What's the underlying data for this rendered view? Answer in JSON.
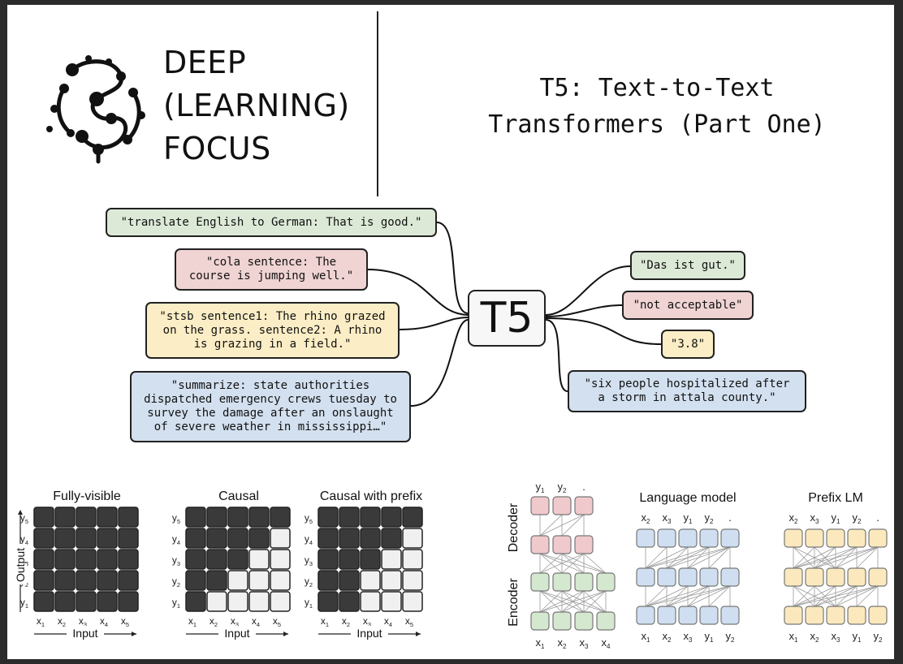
{
  "brand": {
    "line1": "DEEP",
    "line2": "(LEARNING)",
    "line3": "FOCUS"
  },
  "title": {
    "line1": "T5: Text-to-Text",
    "line2": "Transformers (Part One)"
  },
  "center_label": "T5",
  "inputs": [
    {
      "text": "\"translate English to German: That is good.\"",
      "color": "#dde9d7"
    },
    {
      "text": "\"cola sentence: The\ncourse is jumping well.\"",
      "color": "#f0d3d3"
    },
    {
      "text": "\"stsb sentence1: The rhino grazed\non the grass. sentence2: A rhino\nis grazing in a field.\"",
      "color": "#fbedc5"
    },
    {
      "text": "\"summarize: state authorities\ndispatched emergency crews tuesday to\nsurvey the damage after an onslaught\nof severe weather in mississippi…\"",
      "color": "#d3e0ef"
    }
  ],
  "outputs": [
    {
      "text": "\"Das ist gut.\"",
      "color": "#dde9d7"
    },
    {
      "text": "\"not acceptable\"",
      "color": "#f0d3d3"
    },
    {
      "text": "\"3.8\"",
      "color": "#fbedc5"
    },
    {
      "text": "\"six people hospitalized after\na storm in attala county.\"",
      "color": "#d3e0ef"
    }
  ],
  "masks": {
    "titles": [
      "Fully-visible",
      "Causal",
      "Causal with prefix"
    ],
    "y_labels": [
      "y5",
      "y4",
      "y3",
      "y2",
      "y1"
    ],
    "x_labels": [
      "x1",
      "x2",
      "x3",
      "x4",
      "x5"
    ],
    "output_label": "Output",
    "input_label": "Input"
  },
  "architectures": {
    "encoder_decoder": {
      "decoder_label": "Decoder",
      "encoder_label": "Encoder",
      "top_tokens": [
        "y1",
        "y2",
        "."
      ],
      "bottom_tokens": [
        "x1",
        "x2",
        "x3",
        "x4"
      ]
    },
    "language_model": {
      "title": "Language model",
      "top_tokens": [
        "x2",
        "x3",
        "y1",
        "y2",
        "."
      ],
      "bottom_tokens": [
        "x1",
        "x2",
        "x3",
        "y1",
        "y2"
      ]
    },
    "prefix_lm": {
      "title": "Prefix LM",
      "top_tokens": [
        "x2",
        "x3",
        "y1",
        "y2",
        "."
      ],
      "bottom_tokens": [
        "x1",
        "x2",
        "x3",
        "y1",
        "y2"
      ]
    }
  },
  "colors": {
    "dark_cell": "#3a3a3a",
    "light_cell": "#f0f0f0",
    "decoder": "#f0c9cc",
    "encoder": "#d4e7cf",
    "lm": "#cfdff1",
    "prefix": "#fbe9bd"
  }
}
